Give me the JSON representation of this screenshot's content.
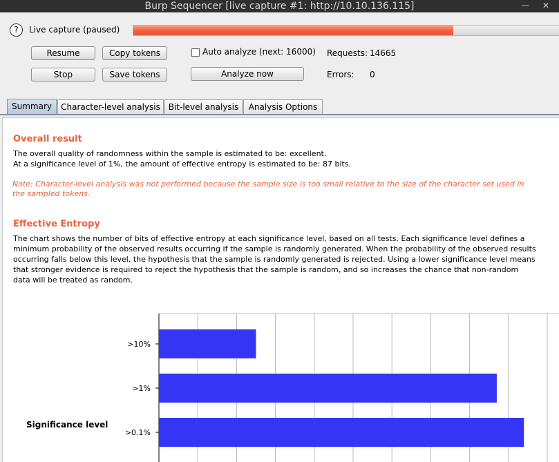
{
  "window": {
    "title": "Burp Sequencer [live capture #1: http://10.10.136.115]"
  },
  "capture": {
    "status_label": "Live capture (paused)",
    "progress_fraction": 0.751,
    "progress_color": "#f06040"
  },
  "controls": {
    "resume_label": "Resume",
    "copy_tokens_label": "Copy tokens",
    "stop_label": "Stop",
    "save_tokens_label": "Save tokens",
    "auto_analyze_label": "Auto analyze (next: 16000)",
    "auto_analyze_checked": false,
    "analyze_now_label": "Analyze now"
  },
  "stats": {
    "requests_label": "Requests:",
    "requests_value": "14665",
    "errors_label": "Errors:",
    "errors_value": "0"
  },
  "tabs": [
    {
      "label": "Summary",
      "active": true
    },
    {
      "label": "Character-level analysis",
      "active": false
    },
    {
      "label": "Bit-level analysis",
      "active": false
    },
    {
      "label": "Analysis Options",
      "active": false
    }
  ],
  "summary": {
    "overall_heading": "Overall result",
    "overall_line1": "The overall quality of randomness within the sample is estimated to be: excellent.",
    "overall_line2": "At a significance level of 1%, the amount of effective entropy is estimated to be: 87 bits.",
    "note_line1": "Note: Character-level analysis was not performed because the sample size is too small relative to the size of the character set used in",
    "note_line2": "the sampled tokens.",
    "entropy_heading": "Effective Entropy",
    "entropy_lines": [
      "The chart shows the number of bits of effective entropy at each significance level, based on all tests. Each significance level defines a",
      "minimum probability of the observed results occurring if the sample is randomly generated. When the probability of the observed results",
      "occurring falls below this level, the hypothesis that the sample is randomly generated is rejected. Using a lower significance level means",
      "that stronger evidence is required to reject the hypothesis that the sample is random, and so increases the chance that non-random",
      "data will be treated as random."
    ]
  },
  "chart_data": {
    "type": "bar",
    "orientation": "horizontal",
    "categories": [
      ">10%",
      ">1%",
      ">0.1%"
    ],
    "values": [
      25,
      87,
      94
    ],
    "ylabel": "Significance level",
    "xlim": [
      0,
      100
    ],
    "grid": true,
    "bar_color": "#3535f5"
  }
}
